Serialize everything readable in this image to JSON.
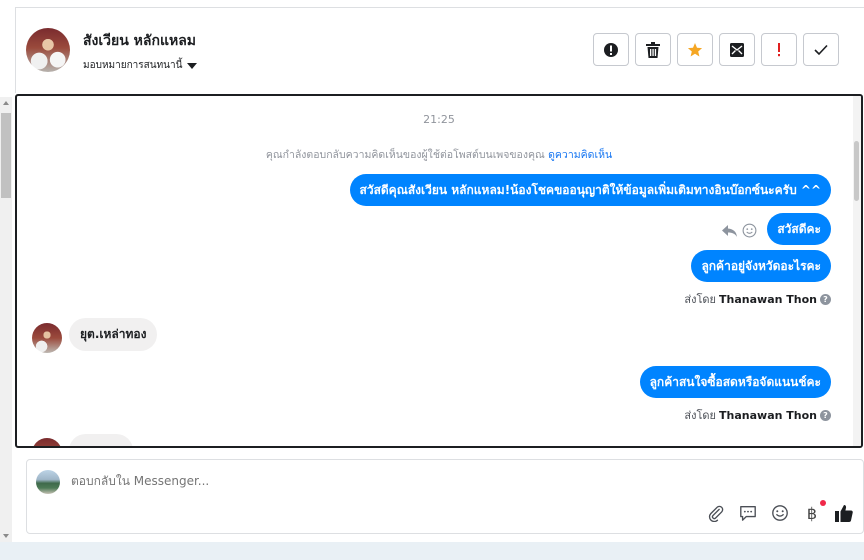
{
  "header": {
    "contact_name": "สังเวียน หลักแหลม",
    "assign_label": "มอบหมายการสนทนานี้",
    "actions": [
      {
        "name": "report-spam-button",
        "icon": "alert-circle-icon"
      },
      {
        "name": "delete-button",
        "icon": "trash-icon"
      },
      {
        "name": "star-button",
        "icon": "star-icon",
        "color": "#f5a623"
      },
      {
        "name": "mark-unread-button",
        "icon": "envelope-icon"
      },
      {
        "name": "important-button",
        "icon": "exclamation-icon",
        "color": "#e02020"
      },
      {
        "name": "mark-done-button",
        "icon": "check-icon"
      }
    ]
  },
  "conversation": {
    "time": "21:25",
    "notice_text": "คุณกำลังตอบกลับความคิดเห็นของผู้ใช้ต่อโพสต์บนเพจของคุณ",
    "notice_link": "ดูความคิดเห็น",
    "messages": [
      {
        "dir": "out",
        "text": "สวัสดีคุณสังเวียน หลักแหลม!น้องโชคขออนุญาติให้ข้อมูลเพิ่มเติมทางอินบ๊อกซ์นะครับ ^^"
      },
      {
        "dir": "out",
        "text": "สวัสดีคะ"
      },
      {
        "dir": "out",
        "text": "ลูกค้าอยู่จังหวัดอะไรคะ"
      },
      {
        "dir": "in",
        "text": "ยุต.เหล่าทอง"
      },
      {
        "dir": "out",
        "text": "ลูกค้าสนใจซื้อสดหรือจัดแนนช์คะ"
      }
    ],
    "sent_by_prefix": "ส่งโดย",
    "sent_by_name": "Thanawan Thon",
    "help_glyph": "?"
  },
  "reply": {
    "placeholder": "ตอบกลับใน Messenger...",
    "tools": [
      "paperclip-icon",
      "saved-replies-icon",
      "emoji-icon",
      "baht-icon",
      "like-icon"
    ],
    "baht_glyph": "฿",
    "accent_color": "#0084ff"
  }
}
